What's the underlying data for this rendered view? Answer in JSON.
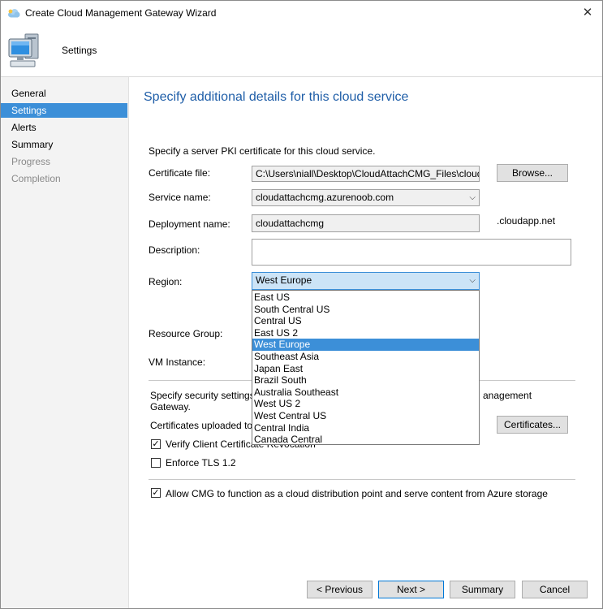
{
  "window": {
    "title": "Create Cloud Management Gateway Wizard"
  },
  "header": {
    "title": "Settings"
  },
  "nav": {
    "items": [
      {
        "label": "General",
        "state": "normal"
      },
      {
        "label": "Settings",
        "state": "active"
      },
      {
        "label": "Alerts",
        "state": "normal"
      },
      {
        "label": "Summary",
        "state": "normal"
      },
      {
        "label": "Progress",
        "state": "disabled"
      },
      {
        "label": "Completion",
        "state": "disabled"
      }
    ]
  },
  "page": {
    "heading": "Specify additional details for this cloud service",
    "pki_intro": "Specify a server PKI certificate for this cloud service.",
    "certificate_file": {
      "label": "Certificate file:",
      "value": "C:\\Users\\niall\\Desktop\\CloudAttachCMG_Files\\clouda",
      "browse": "Browse..."
    },
    "service_name": {
      "label": "Service name:",
      "value": "cloudattachcmg.azurenoob.com"
    },
    "deployment_name": {
      "label": "Deployment name:",
      "value": "cloudattachcmg",
      "suffix": ".cloudapp.net"
    },
    "description": {
      "label": "Description:",
      "value": ""
    },
    "region": {
      "label": "Region:",
      "selected": "West Europe",
      "options": [
        "East US",
        "South Central US",
        "Central US",
        "East US 2",
        "West Europe",
        "Southeast Asia",
        "Japan East",
        "Brazil South",
        "Australia Southeast",
        "West US 2",
        "West Central US",
        "Central India",
        "Canada Central"
      ]
    },
    "resource_group": {
      "label": "Resource Group:"
    },
    "vm_instance": {
      "label": "VM Instance:"
    },
    "security_text_left": "Specify security settings",
    "security_text_right": "anagement",
    "security_text_line2": "Gateway.",
    "certs_uploaded_label": "Certificates uploaded to",
    "certificates_button": "Certificates...",
    "verify_revocation": {
      "label": "Verify Client Certificate Revocation",
      "checked": true
    },
    "enforce_tls": {
      "label": "Enforce TLS 1.2",
      "checked": false
    },
    "allow_cmg": {
      "label": "Allow CMG to function as a cloud distribution point and serve content from Azure storage",
      "checked": true
    }
  },
  "footer": {
    "previous": "< Previous",
    "next": "Next >",
    "summary": "Summary",
    "cancel": "Cancel"
  },
  "colors": {
    "accent": "#3c8fd8",
    "heading": "#1f5ea8"
  },
  "icons": {
    "title": "cloud-icon",
    "header": "computer-icon",
    "close": "close-icon",
    "dropdown": "chevron-down-icon",
    "check": "checkmark-icon"
  }
}
